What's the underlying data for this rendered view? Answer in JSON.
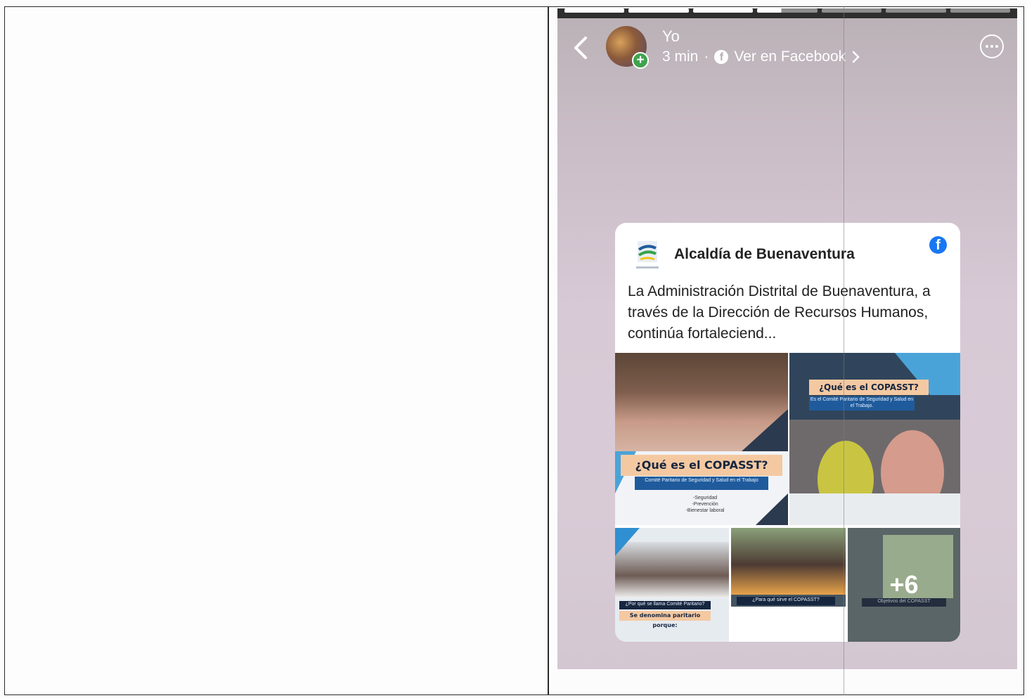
{
  "story": {
    "user_name": "Yo",
    "time": "3 min",
    "separator": "·",
    "view_on": "Ver en Facebook",
    "progress_segments": 7,
    "progress_active_index": 3
  },
  "post": {
    "page_name": "Alcaldía de Buenaventura",
    "text": "La Administración Distrital de Buenaventura, a través de la Dirección de Recursos Humanos, continúa fortaleciend...",
    "photo1": {
      "title": "¿Qué es el COPASST?",
      "subtitle": "Comité Paritario de Seguridad y Salud en el Trabajo",
      "bullets": [
        "-Seguridad",
        "-Prevención",
        "-Bienestar laboral"
      ]
    },
    "photo2": {
      "title": "¿Qué es el COPASST?",
      "subtitle": "Es el Comité Paritario de Seguridad y Salud en el Trabajo."
    },
    "photo3": {
      "title": "¿Por qué se llama Comité Paritario?",
      "subtitle": "Se denomina paritario porque:"
    },
    "photo4": {
      "title": "¿Para qué sirve el COPASST?"
    },
    "photo5": {
      "title": "Objetivos del COPASST",
      "more_count": "+6"
    }
  },
  "colors": {
    "facebook_blue": "#1877f2",
    "status_green": "#3fa34d",
    "banner_peach": "#f4c9a2",
    "navy": "#1f5b9c"
  },
  "icons": [
    "back-chevron-icon",
    "plus-icon",
    "facebook-icon",
    "chevron-right-icon",
    "more-options-icon"
  ]
}
